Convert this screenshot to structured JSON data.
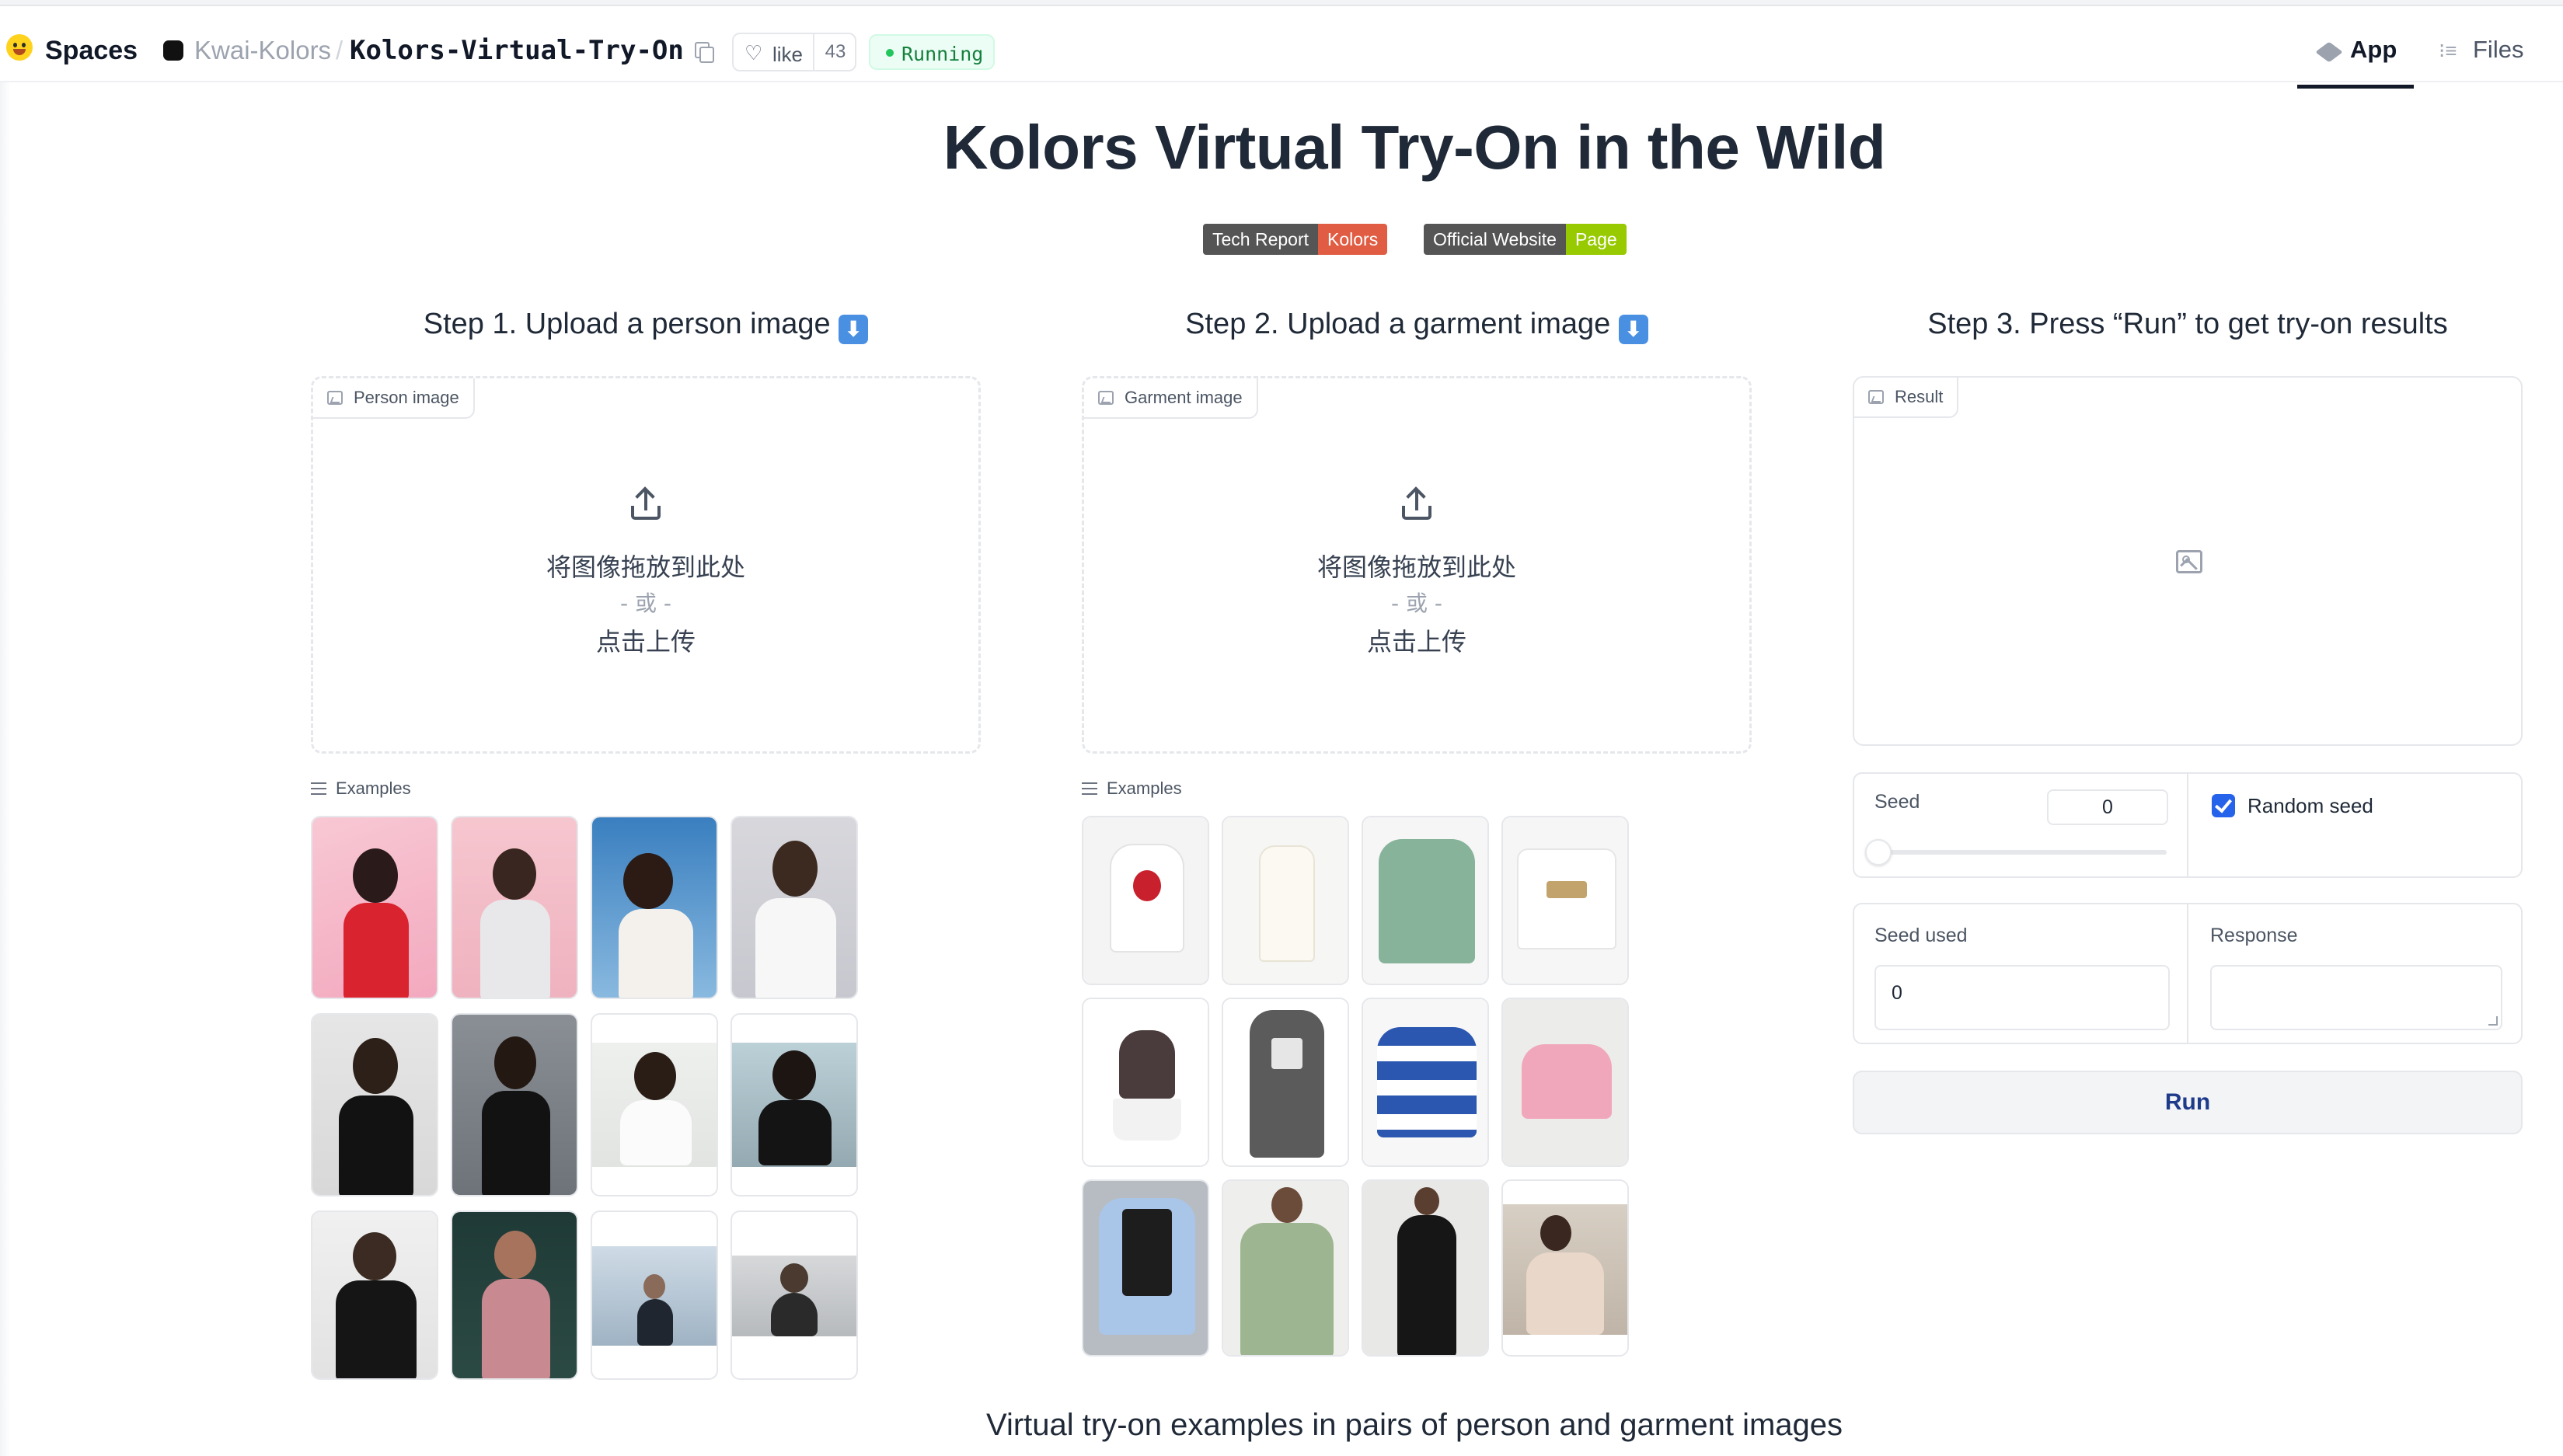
{
  "header": {
    "spaces_label": "Spaces",
    "org": "Kwai-Kolors",
    "separator": "/",
    "repo": "Kolors-Virtual-Try-On",
    "like_label": "like",
    "like_count": "43",
    "status": "Running",
    "tabs": [
      {
        "label": "App",
        "active": true
      },
      {
        "label": "Files",
        "active": false
      }
    ]
  },
  "title": "Kolors Virtual Try-On in the Wild",
  "badges": [
    {
      "left": "Tech Report",
      "right": "Kolors",
      "color": "#e05d44"
    },
    {
      "left": "Official Website",
      "right": "Page",
      "color": "#97ca00"
    }
  ],
  "steps": {
    "step1": "Step 1. Upload a person image",
    "step2": "Step 2. Upload a garment image",
    "step3": "Step 3. Press “Run” to get try-on results",
    "arrow": "⬇"
  },
  "person_upload": {
    "label": "Person image",
    "drop": "将图像拖放到此处",
    "or": "- 或 -",
    "click": "点击上传"
  },
  "garment_upload": {
    "label": "Garment image",
    "drop": "将图像拖放到此处",
    "or": "- 或 -",
    "click": "点击上传"
  },
  "result": {
    "label": "Result"
  },
  "examples_label": "Examples",
  "controls": {
    "seed_label": "Seed",
    "seed_value": "0",
    "slider_value": 0,
    "random_seed_label": "Random seed",
    "random_seed_checked": true,
    "seed_used_label": "Seed used",
    "seed_used_value": "0",
    "response_label": "Response",
    "response_value": "",
    "run_label": "Run"
  },
  "footer": "Virtual try-on examples in pairs of person and garment images",
  "colors": {
    "accent": "#2563eb",
    "running": "#22c55e",
    "run_text": "#1e3a8a"
  }
}
